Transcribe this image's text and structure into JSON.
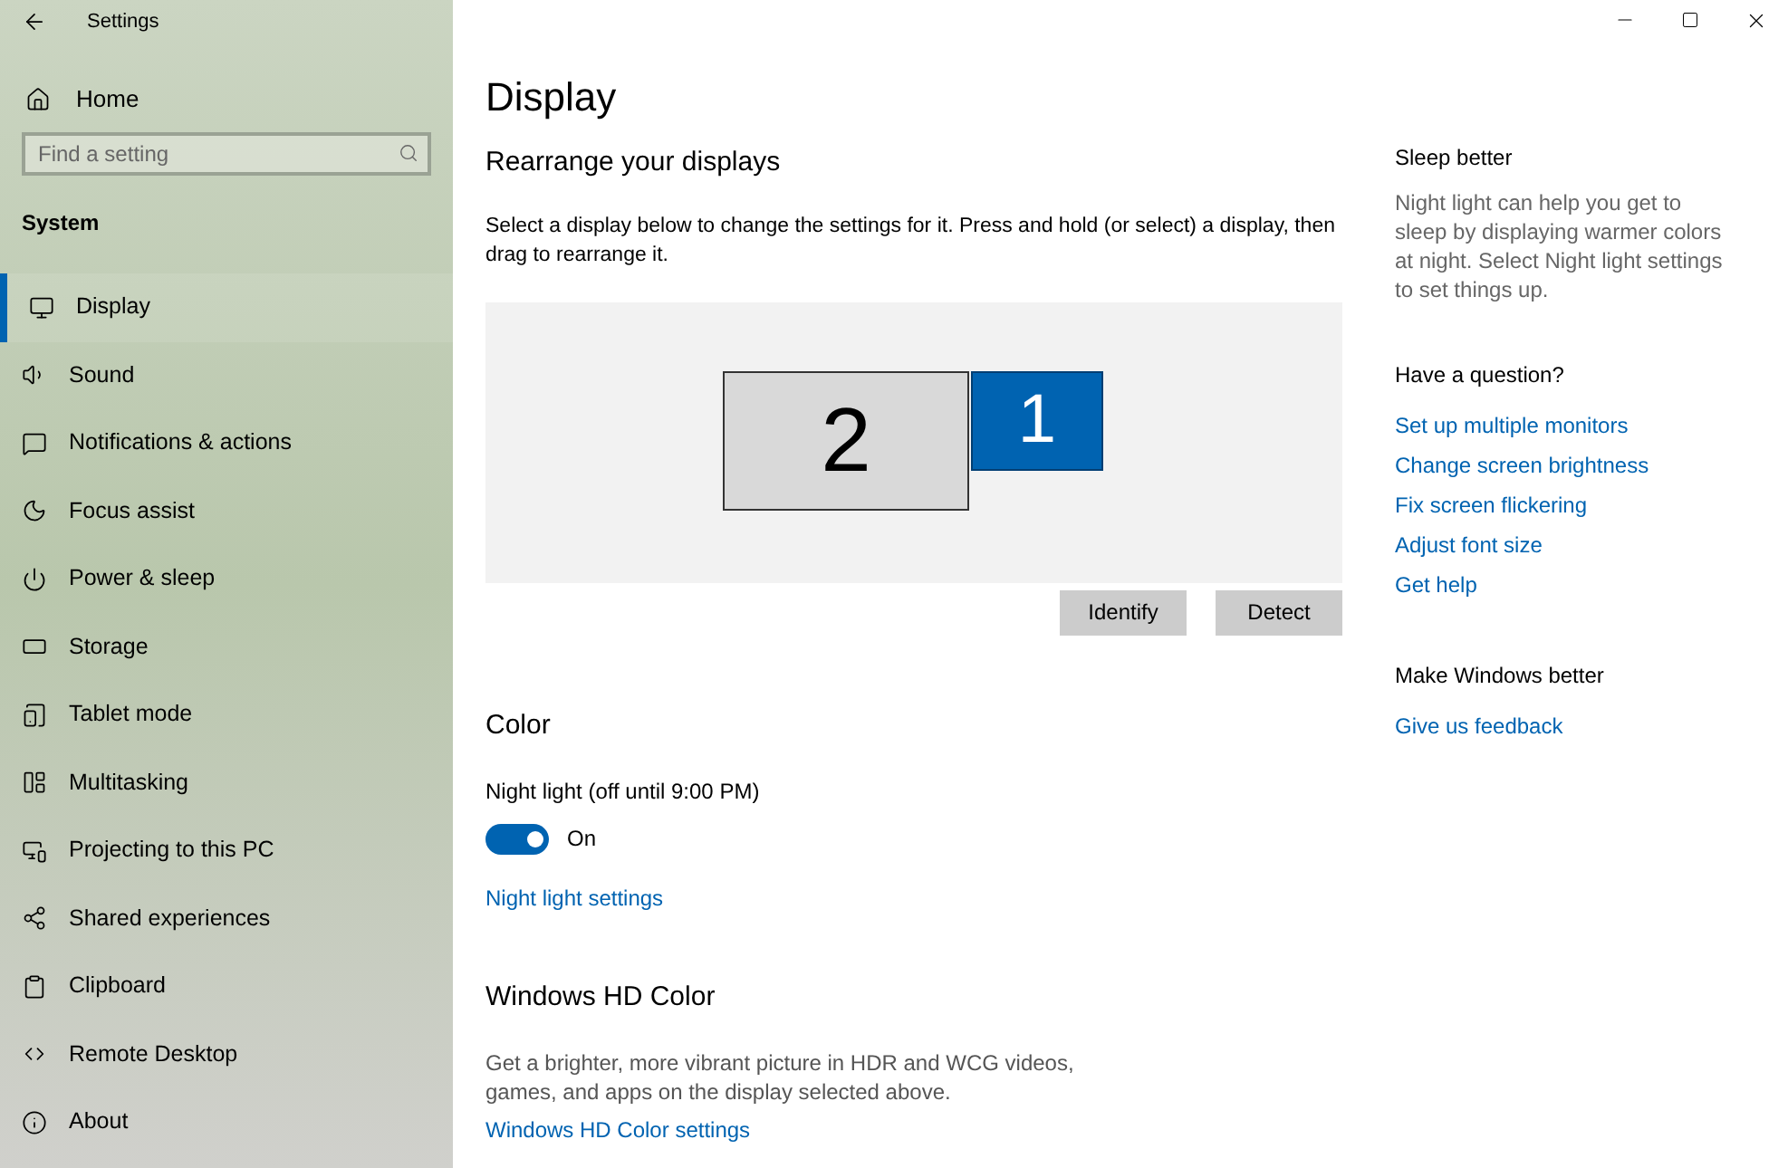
{
  "window": {
    "title": "Settings"
  },
  "sidebar": {
    "home": "Home",
    "search": {
      "placeholder": "Find a setting"
    },
    "section": "System",
    "items": [
      {
        "label": "Display",
        "selected": true
      },
      {
        "label": "Sound",
        "selected": false
      },
      {
        "label": "Notifications & actions",
        "selected": false
      },
      {
        "label": "Focus assist",
        "selected": false
      },
      {
        "label": "Power & sleep",
        "selected": false
      },
      {
        "label": "Storage",
        "selected": false
      },
      {
        "label": "Tablet mode",
        "selected": false
      },
      {
        "label": "Multitasking",
        "selected": false
      },
      {
        "label": "Projecting to this PC",
        "selected": false
      },
      {
        "label": "Shared experiences",
        "selected": false
      },
      {
        "label": "Clipboard",
        "selected": false
      },
      {
        "label": "Remote Desktop",
        "selected": false
      },
      {
        "label": "About",
        "selected": false
      }
    ]
  },
  "page": {
    "title": "Display",
    "rearrange": {
      "heading": "Rearrange your displays",
      "description": "Select a display below to change the settings for it. Press and hold (or select) a display, then drag to rearrange it.",
      "monitors": [
        {
          "label": "2",
          "selected": false
        },
        {
          "label": "1",
          "selected": true
        }
      ],
      "buttons": [
        "Identify",
        "Detect"
      ]
    },
    "color": {
      "heading": "Color",
      "night_light_label": "Night light (off until 9:00 PM)",
      "toggle": {
        "on": true,
        "label": "On"
      },
      "link": "Night light settings"
    },
    "hd_color": {
      "heading": "Windows HD Color",
      "description": "Get a brighter, more vibrant picture in HDR and WCG videos, games, and apps on the display selected above.",
      "link": "Windows HD Color settings"
    }
  },
  "aside": [
    {
      "heading": "Sleep better",
      "text": "Night light can help you get to sleep by displaying warmer colors at night. Select Night light settings to set things up."
    },
    {
      "heading": "Have a question?",
      "links": [
        "Set up multiple monitors",
        "Change screen brightness",
        "Fix screen flickering",
        "Adjust font size",
        "Get help"
      ]
    },
    {
      "heading": "Make Windows better",
      "links": [
        "Give us feedback"
      ]
    }
  ]
}
